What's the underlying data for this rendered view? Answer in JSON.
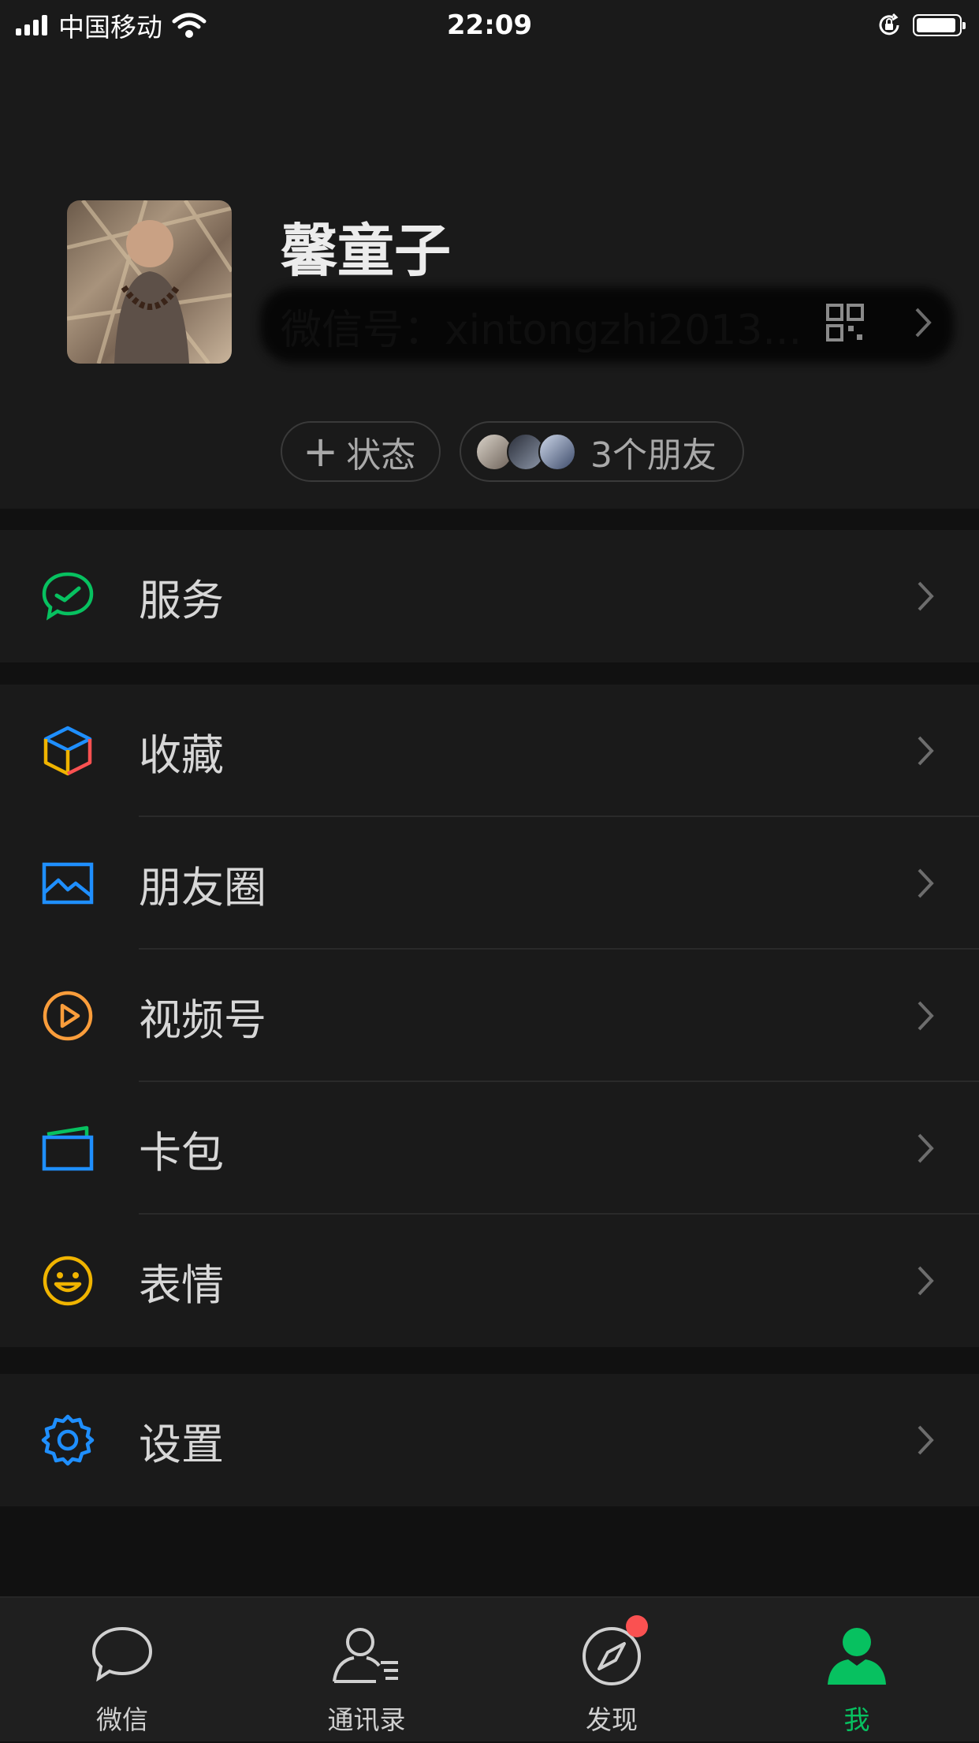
{
  "status_bar": {
    "carrier": "中国移动",
    "time": "22:09"
  },
  "profile": {
    "nickname": "馨童子",
    "wechat_id": "微信号：xintongzhi2013...",
    "status_button": "状态",
    "friends_label": "3个朋友"
  },
  "menu": {
    "service": "服务",
    "favorites": "收藏",
    "moments": "朋友圈",
    "channels": "视频号",
    "wallet": "卡包",
    "stickers": "表情",
    "settings": "设置"
  },
  "tabs": [
    {
      "label": "微信",
      "icon": "chat-bubble-icon"
    },
    {
      "label": "通讯录",
      "icon": "contacts-icon"
    },
    {
      "label": "发现",
      "icon": "compass-icon"
    },
    {
      "label": "我",
      "icon": "person-icon"
    }
  ],
  "active_tab": "我",
  "colors": {
    "accent": "#07c160",
    "badge": "#fa5151",
    "background": "#111111",
    "surface": "#1a1a1a"
  }
}
